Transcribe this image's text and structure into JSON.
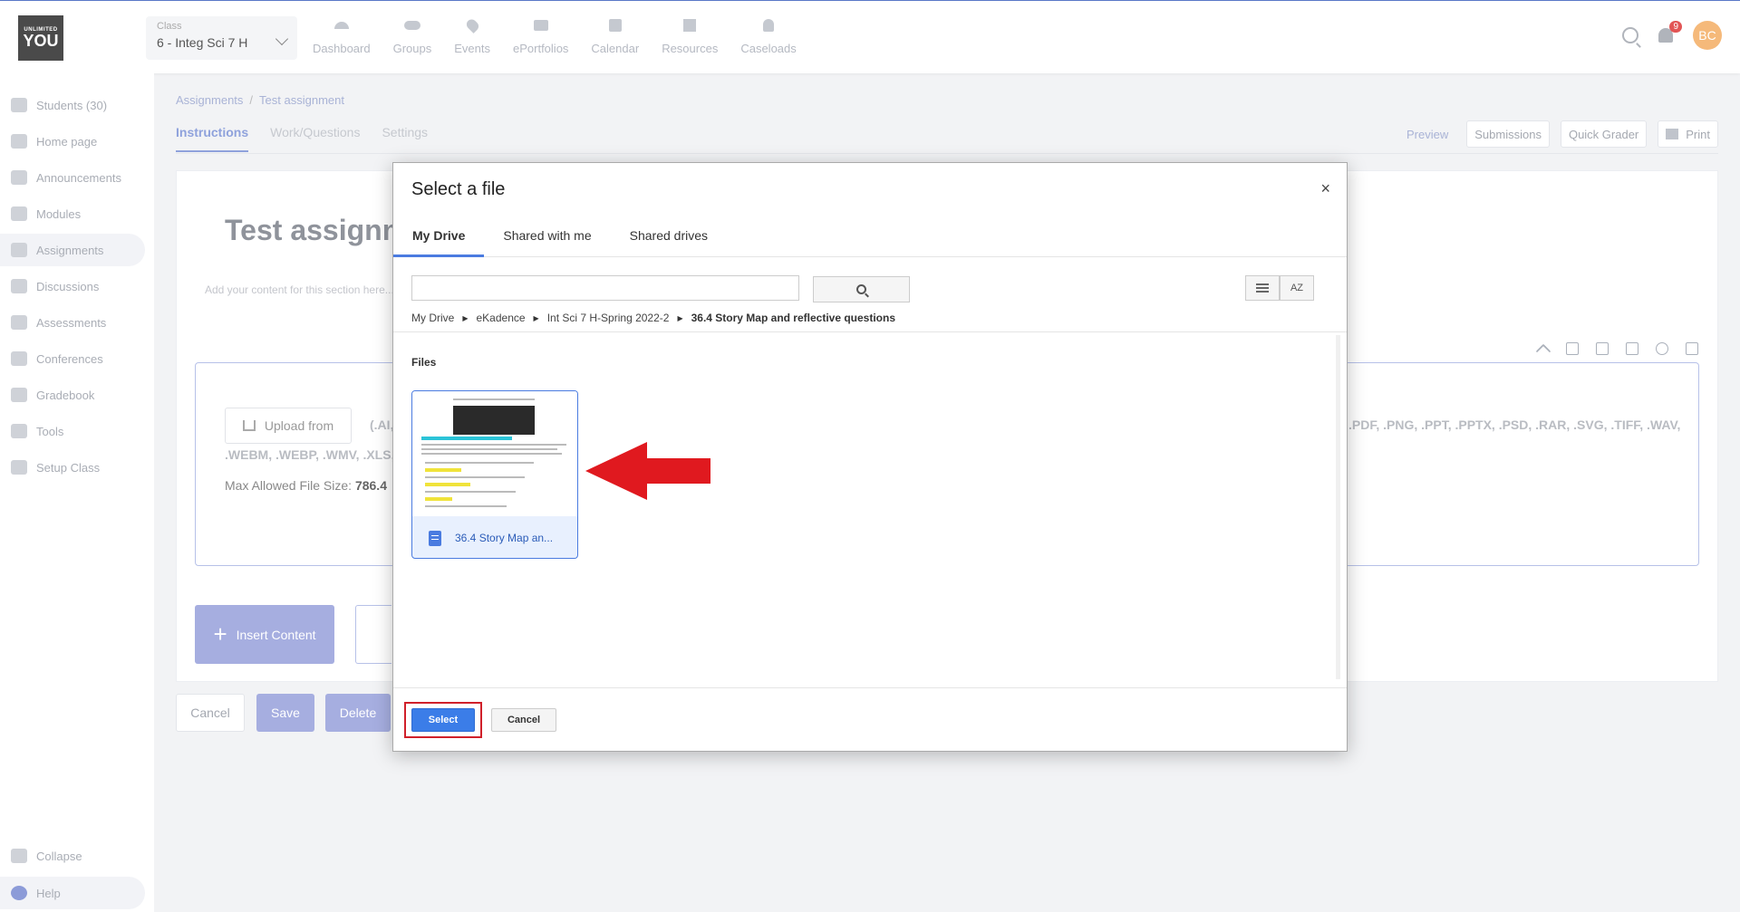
{
  "header": {
    "logo_text": "UNLIMITED YOU",
    "class_label": "Class",
    "class_value": "6 - Integ Sci 7 H",
    "nav": [
      "Dashboard",
      "Groups",
      "Events",
      "ePortfolios",
      "Calendar",
      "Resources",
      "Caseloads"
    ],
    "notification_count": "9",
    "avatar_initials": "BC"
  },
  "sidebar": {
    "items": [
      "Students (30)",
      "Home page",
      "Announcements",
      "Modules",
      "Assignments",
      "Discussions",
      "Assessments",
      "Conferences",
      "Gradebook",
      "Tools",
      "Setup Class"
    ],
    "active": "Assignments",
    "collapse": "Collapse",
    "help": "Help"
  },
  "main": {
    "breadcrumb": [
      "Assignments",
      "Test assignment"
    ],
    "breadcrumb_sep": "/",
    "tabs": [
      "Instructions",
      "Work/Questions",
      "Settings"
    ],
    "actions": {
      "preview": "Preview",
      "submissions": "Submissions",
      "quick_grader": "Quick Grader",
      "print": "Print"
    },
    "title": "Test assignm",
    "hint": "Add your content for this section here...",
    "upload_label": "Upload from",
    "ext_left": "(.AI,",
    "ext_right": ".PDF, .PNG, .PPT, .PPTX, .PSD, .RAR, .SVG, .TIFF, .WAV,",
    "ext_line2": ".WEBM, .WEBP, .WMV, .XLS, .X",
    "max_size_label": "Max Allowed File Size:",
    "max_size_value": "786.4",
    "insert_label": "Insert Content",
    "cancel": "Cancel",
    "save": "Save",
    "delete": "Delete"
  },
  "modal": {
    "title": "Select a file",
    "close": "×",
    "tabs": [
      "My Drive",
      "Shared with me",
      "Shared drives"
    ],
    "search_value": "",
    "path": [
      "My Drive",
      "eKadence",
      "Int Sci 7 H-Spring 2022-2",
      "36.4 Story Map and reflective questions"
    ],
    "path_sep": "▶",
    "sort_label": "AZ",
    "files_heading": "Files",
    "file_name": "36.4 Story Map an...",
    "select": "Select",
    "cancel": "Cancel"
  },
  "colors": {
    "accent": "#4a7be0",
    "highlight_outline": "#d0202a",
    "arrow": "#e0191f"
  }
}
